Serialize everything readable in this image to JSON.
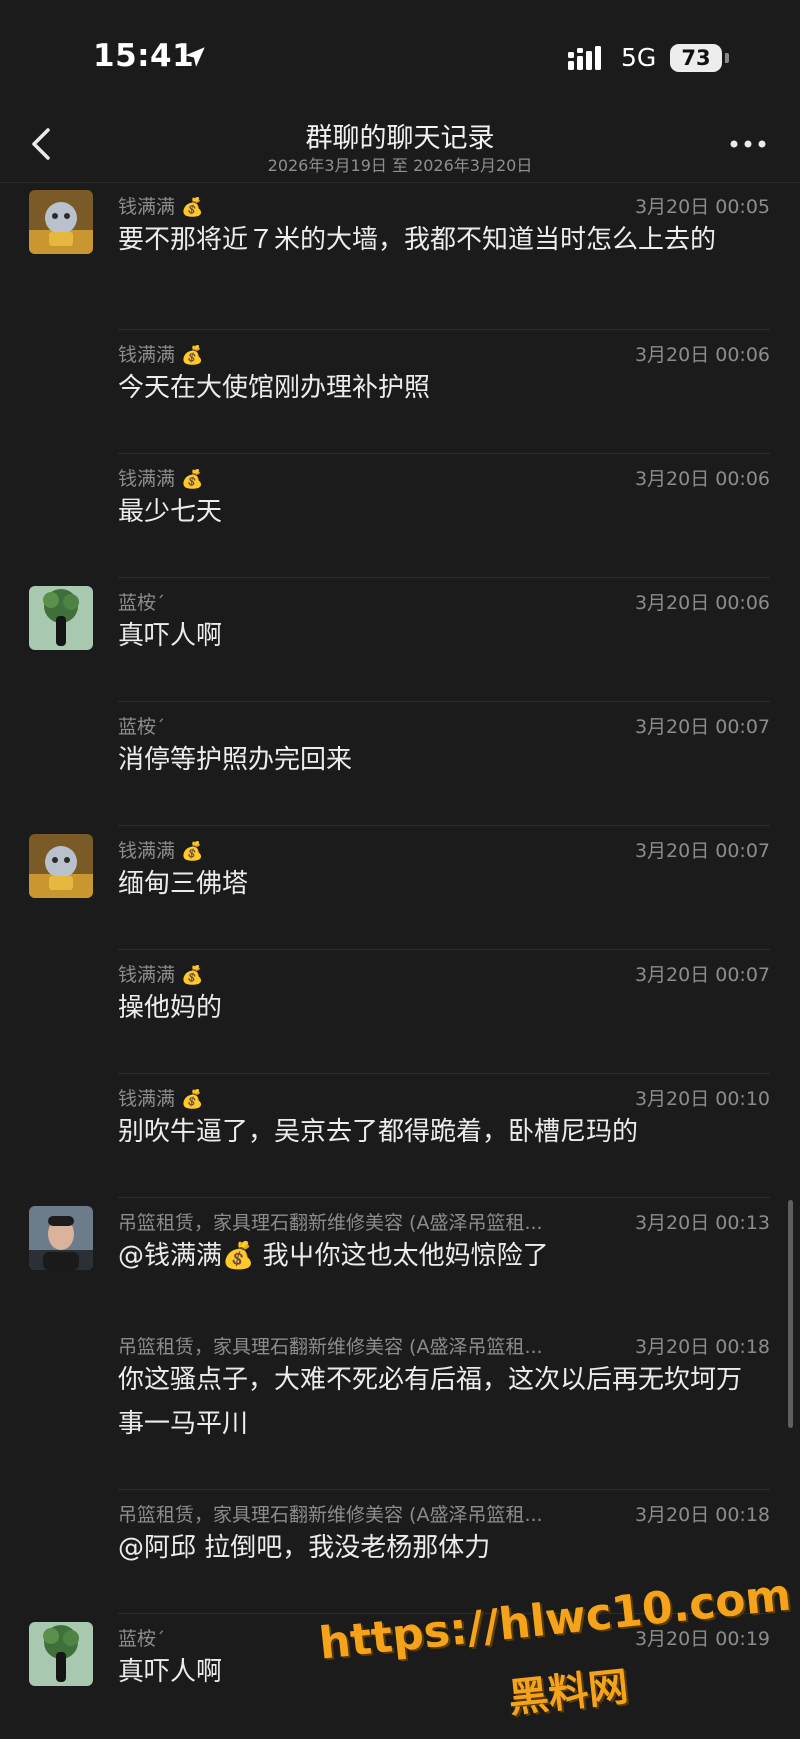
{
  "status_bar": {
    "time": "15:41",
    "network": "5G",
    "battery": "73"
  },
  "nav": {
    "title": "群聊的聊天记录",
    "subtitle": "2026年3月19日 至 2026年3月20日"
  },
  "messages": [
    {
      "sender": "钱满满",
      "badge": "💰",
      "time": "3月20日 00:05",
      "text": "要不那将近７米的大墙，我都不知道当时怎么上去的"
    },
    {
      "sender": "钱满满",
      "badge": "💰",
      "time": "3月20日 00:06",
      "text": "今天在大使馆刚办理补护照"
    },
    {
      "sender": "钱满满",
      "badge": "💰",
      "time": "3月20日 00:06",
      "text": "最少七天"
    },
    {
      "sender": "蓝桉",
      "badge": "ˊ",
      "time": "3月20日 00:06",
      "text": "真吓人啊"
    },
    {
      "sender": "蓝桉",
      "badge": "ˊ",
      "time": "3月20日 00:07",
      "text": "消停等护照办完回来"
    },
    {
      "sender": "钱满满",
      "badge": "💰",
      "time": "3月20日 00:07",
      "text": "缅甸三佛塔"
    },
    {
      "sender": "钱满满",
      "badge": "💰",
      "time": "3月20日 00:07",
      "text": "操他妈的"
    },
    {
      "sender": "钱满满",
      "badge": "💰",
      "time": "3月20日 00:10",
      "text": "别吹牛逼了，吴京去了都得跪着，卧槽尼玛的"
    },
    {
      "sender": "吊篮租赁，家具理石翻新维修美容 (A盛泽吊篮租...",
      "badge": "",
      "time": "3月20日 00:13",
      "text": "@钱满满💰 我屮你这也太他妈惊险了"
    },
    {
      "sender": "吊篮租赁，家具理石翻新维修美容 (A盛泽吊篮租...",
      "badge": "",
      "time": "3月20日 00:18",
      "text": "你这骚点子，大难不死必有后福，这次以后再无坎坷万事一马平川"
    },
    {
      "sender": "吊篮租赁，家具理石翻新维修美容 (A盛泽吊篮租...",
      "badge": "",
      "time": "3月20日 00:18",
      "text": "@阿邱 拉倒吧，我没老杨那体力"
    },
    {
      "sender": "蓝桉",
      "badge": "ˊ",
      "time": "3月20日 00:19",
      "text": "真吓人啊"
    }
  ],
  "watermark": {
    "url": "https://hlwc10.com",
    "name": "黑料网"
  },
  "colors": {
    "background": "#1b1b1b",
    "text": "#ececec",
    "meta": "#8c8c8c",
    "watermark": "#f5a31a"
  },
  "icons": [
    "location-arrow-icon",
    "signal-bars-icon",
    "back-chevron-icon",
    "more-dots-icon"
  ]
}
